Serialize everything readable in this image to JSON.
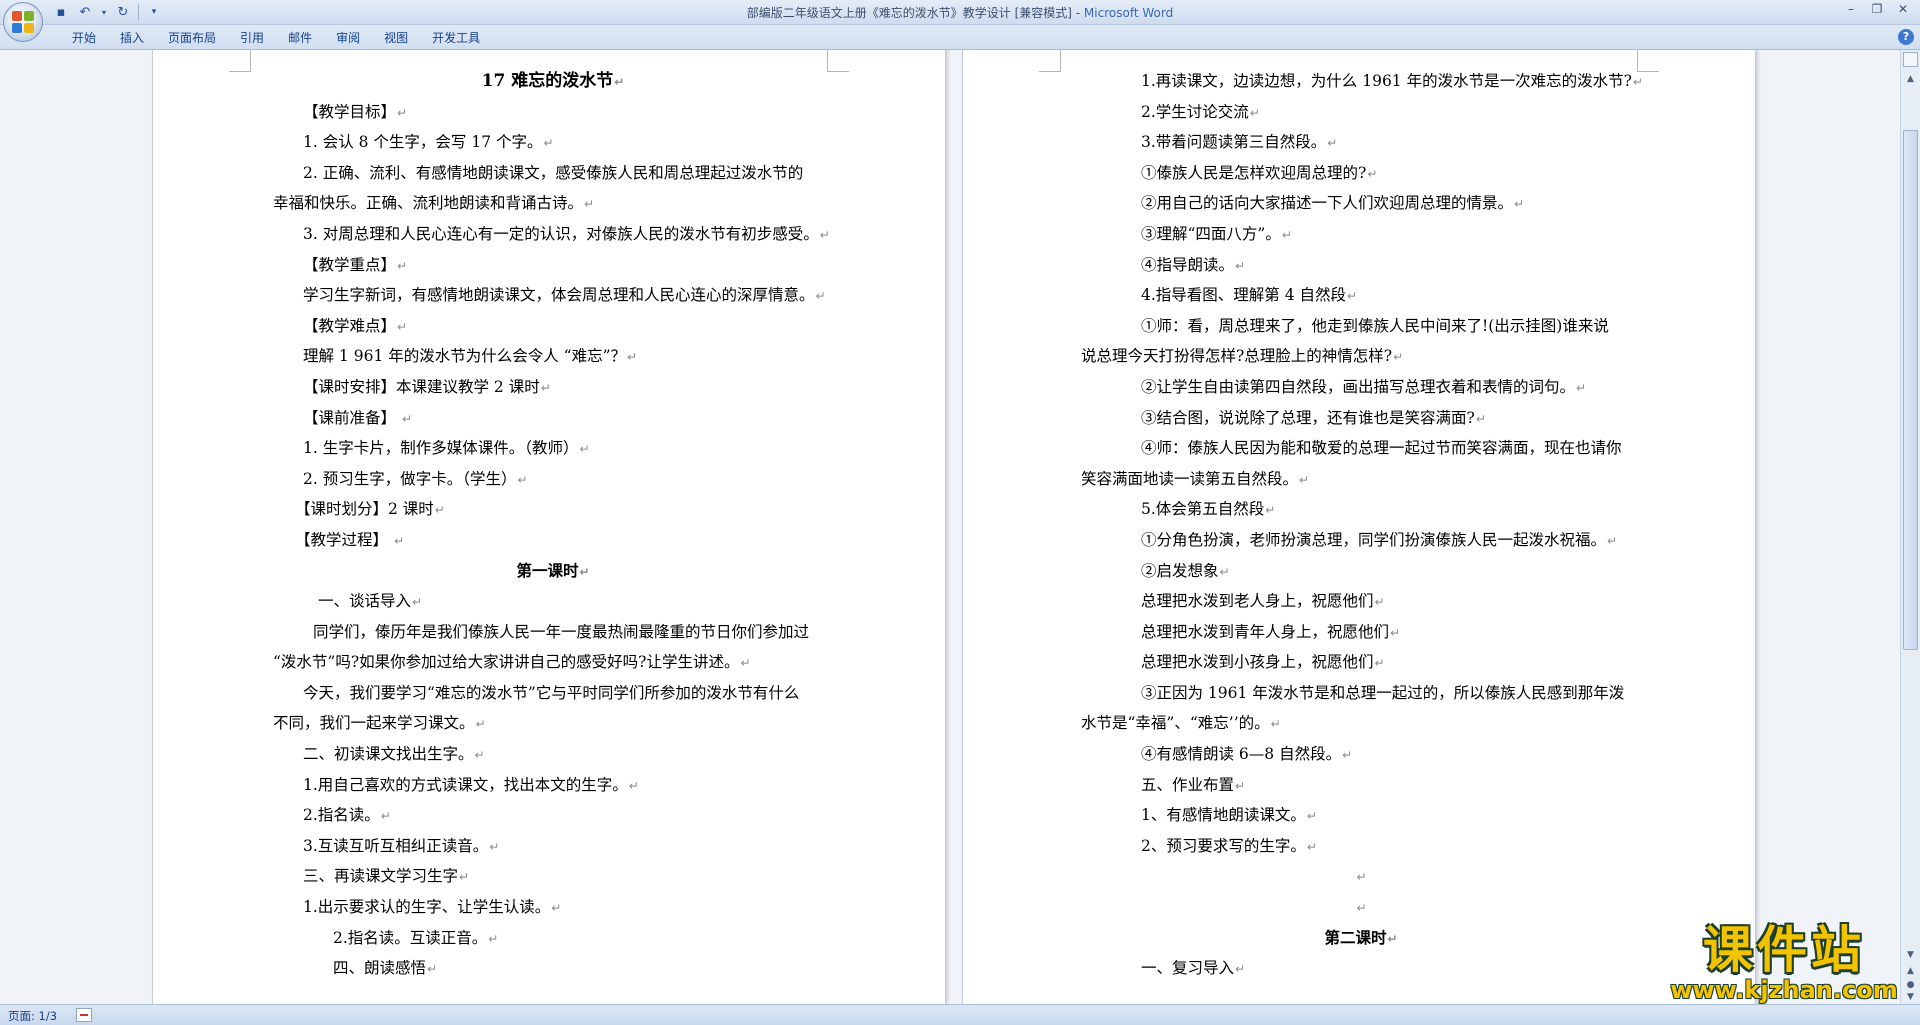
{
  "window": {
    "title": "部编版二年级语文上册《难忘的泼水节》教学设计 [兼容模式] - ",
    "app_name": "Microsoft Word"
  },
  "ribbon": {
    "tabs": [
      "开始",
      "插入",
      "页面布局",
      "引用",
      "邮件",
      "审阅",
      "视图",
      "开发工具"
    ]
  },
  "paragraph_mark": "↵",
  "left_page": {
    "lines": [
      {
        "text": "17  难忘的泼水节",
        "indent": 0,
        "style": "title"
      },
      {
        "text": "【教学目标】",
        "indent": 30
      },
      {
        "text": "1.  会认 8 个生字，会写 17 个字。",
        "indent": 30
      },
      {
        "text": "2.  正确、流利、有感情地朗读课文，感受傣族人民和周总理起过泼水节的",
        "indent": 30,
        "nomark": true
      },
      {
        "text": "幸福和快乐。正确、流利地朗读和背诵古诗。",
        "indent": 0
      },
      {
        "text": "3.  对周总理和人民心连心有一定的认识，对傣族人民的泼水节有初步感受。",
        "indent": 30
      },
      {
        "text": "【教学重点】",
        "indent": 30
      },
      {
        "text": "学习生字新词，有感情地朗读课文，体会周总理和人民心连心的深厚情意。",
        "indent": 30
      },
      {
        "text": "【教学难点】",
        "indent": 30
      },
      {
        "text": "理解 1 961 年的泼水节为什么会令人 “难忘”？",
        "indent": 30
      },
      {
        "text": "【课时安排】本课建议教学 2 课时",
        "indent": 30
      },
      {
        "text": "【课前准备】  ",
        "indent": 30
      },
      {
        "text": "1.  生字卡片，制作多媒体课件。（教师）",
        "indent": 30
      },
      {
        "text": "2.  预习生字，做字卡。（学生）",
        "indent": 30
      },
      {
        "text": "【课时划分】2 课时",
        "indent": 22
      },
      {
        "text": "【教学过程】 ",
        "indent": 22
      },
      {
        "text": "第一课时",
        "indent": 0,
        "style": "center-bold"
      },
      {
        "text": "一、谈话导入",
        "indent": 45
      },
      {
        "text": "同学们，傣历年是我们傣族人民一年一度最热闹最隆重的节日你们参加过",
        "indent": 40,
        "nomark": true
      },
      {
        "text": "“泼水节”吗?如果你参加过给大家讲讲自己的感受好吗?让学生讲述。",
        "indent": 0
      },
      {
        "text": "今天，我们要学习“难忘的泼水节”它与平时同学们所参加的泼水节有什么",
        "indent": 30,
        "nomark": true
      },
      {
        "text": "不同，我们一起来学习课文。",
        "indent": 0
      },
      {
        "text": "二、初读课文找出生字。",
        "indent": 30
      },
      {
        "text": "1.用自己喜欢的方式读课文，找出本文的生字。",
        "indent": 30
      },
      {
        "text": "2.指名读。",
        "indent": 30
      },
      {
        "text": "3.互读互听互相纠正读音。",
        "indent": 30
      },
      {
        "text": "三、再读课文学习生字",
        "indent": 30
      },
      {
        "text": "1.出示要求认的生字、让学生认读。",
        "indent": 30
      },
      {
        "text": "2.指名读。互读正音。",
        "indent": 60
      },
      {
        "text": "四、朗读感悟",
        "indent": 60
      }
    ]
  },
  "right_page": {
    "lines": [
      {
        "text": "1.再读课文，边读边想，为什么 1961 年的泼水节是一次难忘的泼水节?",
        "indent": 60
      },
      {
        "text": "2.学生讨论交流",
        "indent": 60
      },
      {
        "text": "3.带着问题读第三自然段。",
        "indent": 60
      },
      {
        "text": "①傣族人民是怎样欢迎周总理的?",
        "indent": 60
      },
      {
        "text": "②用自己的话向大家描述一下人们欢迎周总理的情景。",
        "indent": 60
      },
      {
        "text": "③理解“四面八方”。",
        "indent": 60
      },
      {
        "text": "④指导朗读。",
        "indent": 60
      },
      {
        "text": "4.指导看图、理解第 4 自然段",
        "indent": 60
      },
      {
        "text": "①师：看，周总理来了，他走到傣族人民中间来了!(出示挂图)谁来说",
        "indent": 60,
        "nomark": true
      },
      {
        "text": "说总理今天打扮得怎样?总理脸上的神情怎样?",
        "indent": 0
      },
      {
        "text": "②让学生自由读第四自然段，画出描写总理衣着和表情的词句。",
        "indent": 60
      },
      {
        "text": "③结合图，说说除了总理，还有谁也是笑容满面?",
        "indent": 60
      },
      {
        "text": "④师：傣族人民因为能和敬爱的总理一起过节而笑容满面，现在也请你",
        "indent": 60,
        "nomark": true
      },
      {
        "text": "笑容满面地读一读第五自然段。",
        "indent": 0
      },
      {
        "text": "5.体会第五自然段",
        "indent": 60
      },
      {
        "text": "①分角色扮演，老师扮演总理，同学们扮演傣族人民一起泼水祝福。",
        "indent": 60
      },
      {
        "text": "②启发想象",
        "indent": 60
      },
      {
        "text": "总理把水泼到老人身上，祝愿他们",
        "indent": 60
      },
      {
        "text": "总理把水泼到青年人身上，祝愿他们",
        "indent": 60
      },
      {
        "text": "总理把水泼到小孩身上，祝愿他们",
        "indent": 60
      },
      {
        "text": "③正因为 1961 年泼水节是和总理一起过的，所以傣族人民感到那年泼",
        "indent": 60,
        "nomark": true
      },
      {
        "text": "水节是“幸福”、“难忘’’的。",
        "indent": 0
      },
      {
        "text": "④有感情朗读 6—8 自然段。",
        "indent": 60
      },
      {
        "text": "五、作业布置",
        "indent": 60
      },
      {
        "text": "1、有感情地朗读课文。",
        "indent": 60
      },
      {
        "text": "2、预习要求写的生字。",
        "indent": 60
      },
      {
        "text": "",
        "indent": 0,
        "style": "center"
      },
      {
        "text": "",
        "indent": 0,
        "style": "center"
      },
      {
        "text": "第二课时",
        "indent": 0,
        "style": "center-bold"
      },
      {
        "text": "一、复习导入",
        "indent": 60
      }
    ]
  },
  "status_bar": {
    "page_info": "页面: 1/3"
  },
  "watermark": {
    "title": "课件站",
    "url": "www.kjzhan.com"
  }
}
